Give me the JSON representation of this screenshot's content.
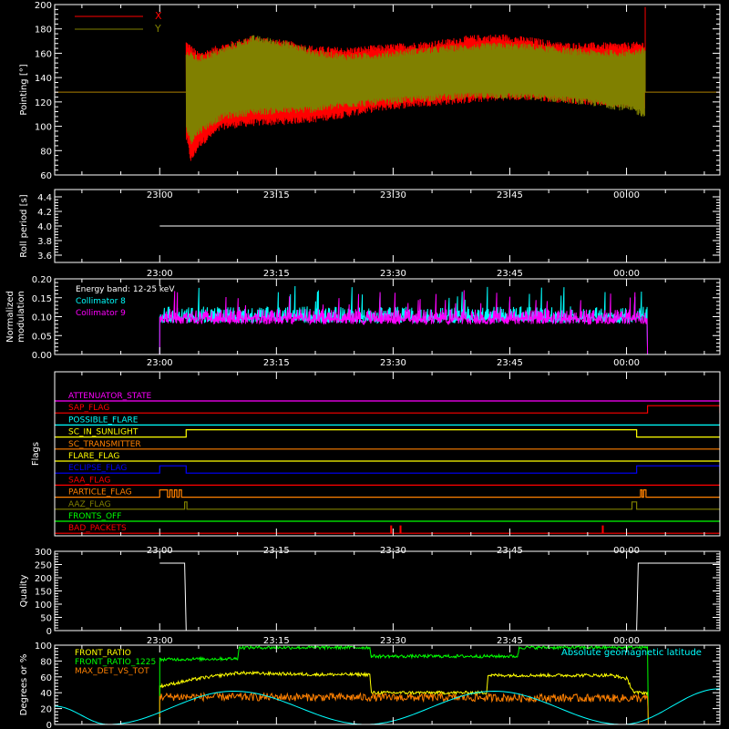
{
  "time_ticks": [
    "23:00",
    "23:15",
    "23:30",
    "23:45",
    "00:00",
    "00:15"
  ],
  "chart_data": [
    {
      "type": "area",
      "ylabel": "Pointing [°]",
      "ylim": [
        60,
        200
      ],
      "yticks": [
        60,
        80,
        100,
        120,
        140,
        160,
        180,
        200
      ],
      "legend": "top-left",
      "colors": {
        "X": "#ff0000",
        "Y": "#808000"
      },
      "series": [
        {
          "name": "X",
          "color": "#ff0000",
          "envelope_upper": [
            [
              0.0,
              128
            ],
            [
              3.3,
              128
            ],
            [
              3.4,
              168
            ],
            [
              5,
              158
            ],
            [
              8,
              165
            ],
            [
              12,
              172
            ],
            [
              16,
              168
            ],
            [
              20,
              163
            ],
            [
              24,
              162
            ],
            [
              28,
              164
            ],
            [
              32,
              166
            ],
            [
              36,
              168
            ],
            [
              40,
              172
            ],
            [
              44,
              173
            ],
            [
              48,
              170
            ],
            [
              52,
              166
            ],
            [
              56,
              166
            ],
            [
              60,
              166
            ],
            [
              62.3,
              167
            ],
            [
              62.4,
              198
            ],
            [
              62.5,
              128
            ],
            [
              72,
              128
            ]
          ],
          "envelope_lower": [
            [
              3.3,
              128
            ],
            [
              3.4,
              90
            ],
            [
              4,
              72
            ],
            [
              5,
              85
            ],
            [
              8,
              100
            ],
            [
              12,
              103
            ],
            [
              16,
              104
            ],
            [
              20,
              106
            ],
            [
              24,
              110
            ],
            [
              28,
              115
            ],
            [
              32,
              118
            ],
            [
              36,
              120
            ],
            [
              40,
              122
            ],
            [
              44,
              124
            ],
            [
              48,
              124
            ],
            [
              52,
              122
            ],
            [
              56,
              120
            ],
            [
              60,
              118
            ],
            [
              62.3,
              116
            ],
            [
              62.4,
              128
            ]
          ]
        },
        {
          "name": "Y",
          "color": "#808000",
          "envelope_upper": [
            [
              0.0,
              128
            ],
            [
              3.3,
              128
            ],
            [
              3.4,
              160
            ],
            [
              5,
              155
            ],
            [
              8,
              162
            ],
            [
              12,
              172
            ],
            [
              16,
              168
            ],
            [
              20,
              160
            ],
            [
              24,
              157
            ],
            [
              28,
              158
            ],
            [
              32,
              161
            ],
            [
              36,
              163
            ],
            [
              40,
              165
            ],
            [
              44,
              166
            ],
            [
              48,
              165
            ],
            [
              52,
              162
            ],
            [
              56,
              160
            ],
            [
              60,
              160
            ],
            [
              62.3,
              162
            ],
            [
              62.4,
              128
            ],
            [
              72,
              128
            ]
          ],
          "envelope_lower": [
            [
              3.3,
              128
            ],
            [
              3.4,
              98
            ],
            [
              4,
              88
            ],
            [
              5,
              96
            ],
            [
              8,
              108
            ],
            [
              12,
              112
            ],
            [
              16,
              113
            ],
            [
              20,
              114
            ],
            [
              24,
              118
            ],
            [
              28,
              120
            ],
            [
              32,
              122
            ],
            [
              36,
              124
            ],
            [
              40,
              125
            ],
            [
              44,
              125
            ],
            [
              48,
              124
            ],
            [
              52,
              122
            ],
            [
              56,
              119
            ],
            [
              60,
              115
            ],
            [
              62.3,
              110
            ],
            [
              62.4,
              128
            ]
          ]
        }
      ]
    },
    {
      "type": "line",
      "ylabel": "Roll period [s]",
      "ylim": [
        3.5,
        4.5
      ],
      "yticks": [
        "3.6",
        "3.8",
        "4.0",
        "4.2",
        "4.4"
      ],
      "series": [
        {
          "color": "#ffffff",
          "points": [
            [
              0,
              4.0
            ],
            [
              72,
              4.0
            ]
          ]
        }
      ]
    },
    {
      "type": "line",
      "ylabel": "Normalized modulation",
      "ylim": [
        0,
        0.2
      ],
      "yticks": [
        "0.00",
        "0.05",
        "0.10",
        "0.15",
        "0.20"
      ],
      "annotations": [
        "Energy band: 12-25 keV"
      ],
      "legend": "top-left",
      "series": [
        {
          "name": "Collimator 8",
          "color": "#00ffff",
          "mean": 0.105,
          "spread": 0.022,
          "active_range": [
            0,
            62.7
          ]
        },
        {
          "name": "Collimator 9",
          "color": "#ff00ff",
          "mean": 0.1,
          "spread": 0.02,
          "active_range": [
            0,
            62.7
          ]
        }
      ]
    },
    {
      "type": "line",
      "ylabel": "Flags",
      "flags": [
        {
          "name": "ATTENUATOR_STATE",
          "color": "#ff00ff",
          "on": []
        },
        {
          "name": "SAP_FLAG",
          "color": "#ff0000",
          "on": [
            [
              62.7,
              72
            ]
          ]
        },
        {
          "name": "POSSIBLE_FLARE",
          "color": "#00ffff",
          "on": []
        },
        {
          "name": "SC_IN_SUNLIGHT",
          "color": "#ffff00",
          "on": [
            [
              3.4,
              61.3
            ]
          ]
        },
        {
          "name": "SC_TRANSMITTER",
          "color": "#ff8000",
          "on": []
        },
        {
          "name": "FLARE_FLAG",
          "color": "#ffff00",
          "on": []
        },
        {
          "name": "ECLIPSE_FLAG",
          "color": "#0000ff",
          "on": [
            [
              0,
              3.4
            ],
            [
              61.3,
              72
            ]
          ]
        },
        {
          "name": "SAA_FLAG",
          "color": "#ff0000",
          "on": []
        },
        {
          "name": "PARTICLE_FLAG",
          "color": "#ff8000",
          "on": [
            [
              0,
              1.0
            ],
            [
              1.3,
              1.6
            ],
            [
              1.9,
              2.2
            ],
            [
              2.5,
              2.8
            ],
            [
              61.8,
              62.0
            ],
            [
              62.2,
              62.5
            ]
          ]
        },
        {
          "name": "AAZ_FLAG",
          "color": "#808000",
          "on": [
            [
              3.2,
              3.5
            ],
            [
              60.7,
              61.3
            ]
          ]
        },
        {
          "name": "FRONTS_OFF",
          "color": "#00ff00",
          "on": []
        },
        {
          "name": "BAD_PACKETS",
          "color": "#ff0000",
          "on": [
            [
              29.7,
              29.8
            ],
            [
              30.9,
              31.0
            ],
            [
              56.9,
              57.0
            ]
          ]
        }
      ]
    },
    {
      "type": "line",
      "ylabel": "Quality",
      "ylim": [
        0,
        300
      ],
      "yticks": [
        0,
        50,
        100,
        150,
        200,
        250,
        300
      ],
      "series": [
        {
          "color": "#ffffff",
          "points": [
            [
              0,
              255
            ],
            [
              3.2,
              255
            ],
            [
              3.4,
              0
            ],
            [
              61.3,
              0
            ],
            [
              61.5,
              255
            ],
            [
              72,
              255
            ]
          ]
        }
      ]
    },
    {
      "type": "line",
      "ylabel": "Degrees or %",
      "ylim": [
        0,
        100
      ],
      "yticks": [
        0,
        20,
        40,
        60,
        80,
        100
      ],
      "legend": "top-left",
      "annotations": [
        "Absolute geomagnetic latitude"
      ],
      "series": [
        {
          "name": "FRONT_RATIO",
          "color": "#ffff00",
          "points": [
            [
              0,
              0
            ],
            [
              0,
              48
            ],
            [
              5,
              58
            ],
            [
              10,
              65
            ],
            [
              20,
              63
            ],
            [
              27,
              63
            ],
            [
              27.2,
              40
            ],
            [
              42,
              40
            ],
            [
              42.2,
              62
            ],
            [
              58,
              62
            ],
            [
              60,
              58
            ],
            [
              61,
              40
            ],
            [
              62.7,
              40
            ],
            [
              62.8,
              0
            ]
          ],
          "noise": 2
        },
        {
          "name": "FRONT_RATIO_1225",
          "color": "#00ff00",
          "points": [
            [
              0,
              0
            ],
            [
              0,
              82
            ],
            [
              10,
              83
            ],
            [
              10.2,
              97
            ],
            [
              27,
              97
            ],
            [
              27.2,
              86
            ],
            [
              46,
              86
            ],
            [
              46.2,
              97
            ],
            [
              60,
              97
            ],
            [
              62.7,
              97
            ],
            [
              62.8,
              0
            ]
          ],
          "noise": 2
        },
        {
          "name": "MAX_DET_VS_TOT",
          "color": "#ff8000",
          "points": [
            [
              0,
              0
            ],
            [
              0,
              35
            ],
            [
              62.7,
              33
            ],
            [
              62.8,
              0
            ]
          ],
          "noise": 5
        },
        {
          "name": "Absolute geomagnetic latitude",
          "color": "#00ffff",
          "points": [
            [
              -13.5,
              23
            ],
            [
              -6.6,
              0
            ],
            [
              9.5,
              42
            ],
            [
              26.5,
              0
            ],
            [
              43,
              42
            ],
            [
              59.5,
              0
            ],
            [
              72,
              45
            ]
          ]
        }
      ]
    }
  ]
}
